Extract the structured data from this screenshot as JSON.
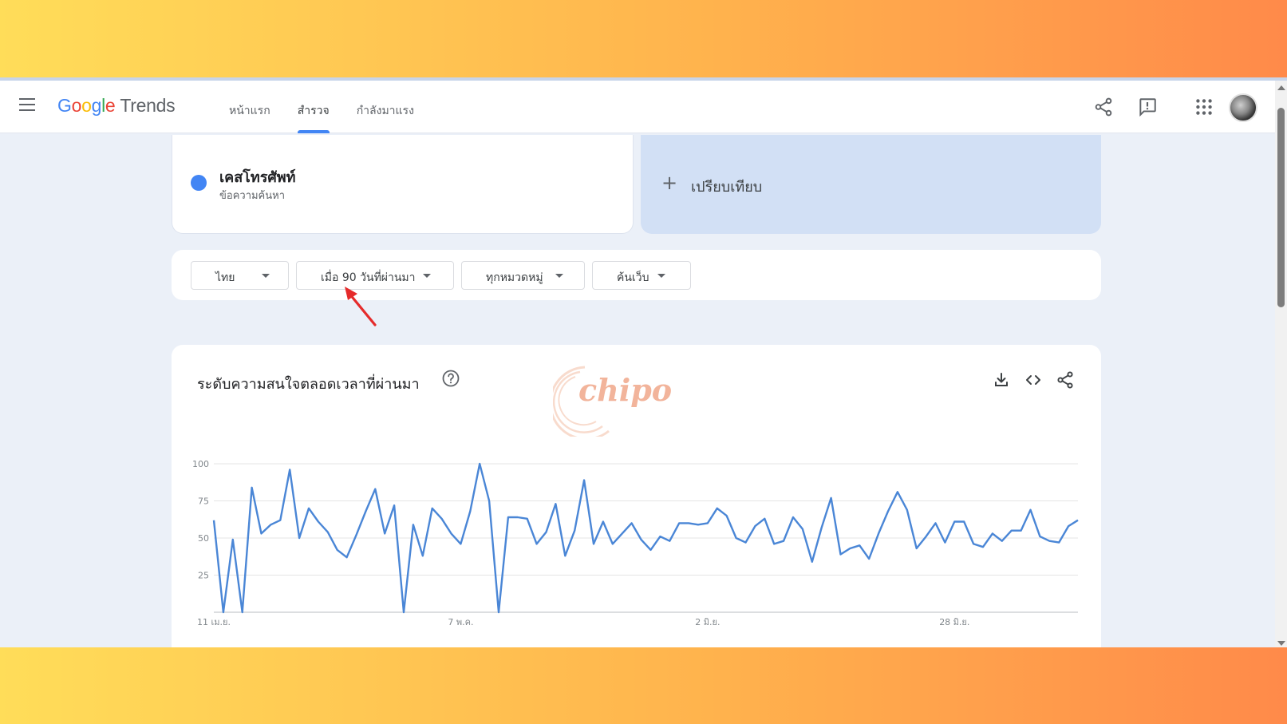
{
  "header": {
    "logo_google": "Google",
    "logo_trends": "Trends",
    "nav": [
      {
        "label": "หน้าแรก",
        "active": false
      },
      {
        "label": "สำรวจ",
        "active": true
      },
      {
        "label": "กำลังมาแรง",
        "active": false
      }
    ]
  },
  "search_term": {
    "name": "เคสโทรศัพท์",
    "type": "ข้อความค้นหา",
    "color": "#4285f4"
  },
  "compare": {
    "plus": "+",
    "label": "เปรียบเทียบ"
  },
  "filters": {
    "region": "ไทย",
    "time_range": "เมื่อ 90 วันที่ผ่านมา",
    "category": "ทุกหมวดหมู่",
    "search_type": "ค้นเว็บ"
  },
  "interest_card": {
    "title": "ระดับความสนใจตลอดเวลาที่ผ่านมา"
  },
  "watermark": "chipo",
  "chart_data": {
    "type": "line",
    "title": "ระดับความสนใจตลอดเวลาที่ผ่านมา",
    "ylim": [
      0,
      100
    ],
    "y_ticks": [
      25,
      50,
      75,
      100
    ],
    "x_ticks": [
      {
        "label": "11 เม.ย.",
        "index": 0
      },
      {
        "label": "7 พ.ค.",
        "index": 26
      },
      {
        "label": "2 มิ.ย.",
        "index": 52
      },
      {
        "label": "28 มิ.ย.",
        "index": 78
      }
    ],
    "grid": true,
    "series": [
      {
        "color": "#4a86d6",
        "values": [
          62,
          0,
          49,
          0,
          84,
          53,
          59,
          62,
          96,
          50,
          70,
          61,
          54,
          42,
          37,
          52,
          68,
          83,
          53,
          72,
          0,
          59,
          38,
          70,
          63,
          53,
          46,
          68,
          100,
          75,
          0,
          64,
          64,
          63,
          46,
          54,
          73,
          38,
          55,
          89,
          46,
          61,
          46,
          53,
          60,
          49,
          42,
          51,
          48,
          60,
          60,
          59,
          60,
          70,
          65,
          50,
          47,
          58,
          63,
          46,
          48,
          64,
          56,
          34,
          57,
          77,
          39,
          43,
          45,
          36,
          53,
          68,
          81,
          69,
          43,
          51,
          60,
          47,
          61,
          61,
          46,
          44,
          53,
          48,
          55,
          55,
          69,
          51,
          48,
          47,
          58,
          62
        ]
      }
    ]
  }
}
